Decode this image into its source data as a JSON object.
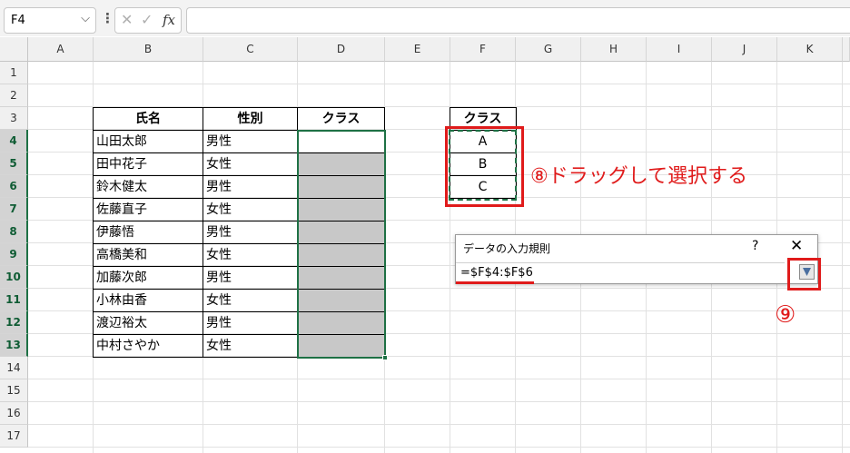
{
  "name_box": {
    "value": "F4"
  },
  "formula_bar": {
    "value": ""
  },
  "columns": [
    "A",
    "B",
    "C",
    "D",
    "E",
    "F",
    "G",
    "H",
    "I",
    "J",
    "K"
  ],
  "rows": [
    "1",
    "2",
    "3",
    "4",
    "5",
    "6",
    "7",
    "8",
    "9",
    "10",
    "11",
    "12",
    "13",
    "14",
    "15",
    "16",
    "17"
  ],
  "table": {
    "headers": [
      "氏名",
      "性別",
      "クラス"
    ],
    "records": [
      {
        "name": "山田太郎",
        "gender": "男性"
      },
      {
        "name": "田中花子",
        "gender": "女性"
      },
      {
        "name": "鈴木健太",
        "gender": "男性"
      },
      {
        "name": "佐藤直子",
        "gender": "女性"
      },
      {
        "name": "伊藤悟",
        "gender": "男性"
      },
      {
        "name": "高橋美和",
        "gender": "女性"
      },
      {
        "name": "加藤次郎",
        "gender": "男性"
      },
      {
        "name": "小林由香",
        "gender": "女性"
      },
      {
        "name": "渡辺裕太",
        "gender": "男性"
      },
      {
        "name": "中村さやか",
        "gender": "女性"
      }
    ]
  },
  "class_list": {
    "header": "クラス",
    "items": [
      "A",
      "B",
      "C"
    ]
  },
  "dialog": {
    "title": "データの入力規則",
    "help": "?",
    "close": "✕",
    "input_value": "=$F$4:$F$6"
  },
  "annotations": {
    "step8": "⑧ドラッグして選択する",
    "step9": "⑨"
  },
  "colors": {
    "accent": "#1e7145",
    "annotation": "#e01b1b",
    "fill": "#c8c8c8"
  }
}
